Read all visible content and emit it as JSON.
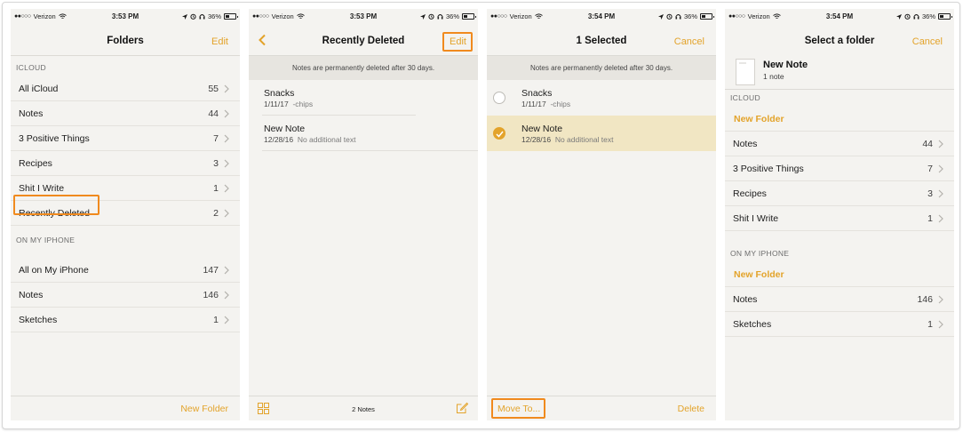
{
  "status": {
    "carrier": "Verizon",
    "battery": "36%",
    "time_a": "3:53 PM",
    "time_b": "3:54 PM"
  },
  "screen1": {
    "title": "Folders",
    "edit": "Edit",
    "section_icloud": "ICLOUD",
    "section_iphone": "ON MY IPHONE",
    "icloud_items": [
      {
        "label": "All iCloud",
        "count": "55"
      },
      {
        "label": "Notes",
        "count": "44"
      },
      {
        "label": "3 Positive Things",
        "count": "7"
      },
      {
        "label": "Recipes",
        "count": "3"
      },
      {
        "label": "Shit I Write",
        "count": "1"
      },
      {
        "label": "Recently Deleted",
        "count": "2"
      }
    ],
    "iphone_items": [
      {
        "label": "All on My iPhone",
        "count": "147"
      },
      {
        "label": "Notes",
        "count": "146"
      },
      {
        "label": "Sketches",
        "count": "1"
      }
    ],
    "new_folder": "New Folder"
  },
  "screen2": {
    "title": "Recently Deleted",
    "edit": "Edit",
    "banner": "Notes are permanently deleted after 30 days.",
    "notes": [
      {
        "title": "Snacks",
        "date": "1/11/17",
        "snippet": "-chips"
      },
      {
        "title": "New Note",
        "date": "12/28/16",
        "snippet": "No additional text"
      }
    ],
    "count": "2 Notes"
  },
  "screen3": {
    "title": "1 Selected",
    "cancel": "Cancel",
    "banner": "Notes are permanently deleted after 30 days.",
    "notes": [
      {
        "title": "Snacks",
        "date": "1/11/17",
        "snippet": "-chips"
      },
      {
        "title": "New Note",
        "date": "12/28/16",
        "snippet": "No additional text"
      }
    ],
    "move_to": "Move To...",
    "delete": "Delete"
  },
  "screen4": {
    "title": "Select a folder",
    "cancel": "Cancel",
    "note_title": "New Note",
    "note_count": "1 note",
    "section_icloud": "ICLOUD",
    "section_iphone": "ON MY IPHONE",
    "new_folder": "New Folder",
    "icloud_items": [
      {
        "label": "Notes",
        "count": "44"
      },
      {
        "label": "3 Positive Things",
        "count": "7"
      },
      {
        "label": "Recipes",
        "count": "3"
      },
      {
        "label": "Shit I Write",
        "count": "1"
      }
    ],
    "iphone_items": [
      {
        "label": "Notes",
        "count": "146"
      },
      {
        "label": "Sketches",
        "count": "1"
      }
    ]
  },
  "colors": {
    "accent": "#e3a32a",
    "highlight": "#f08a1e",
    "selected_row": "#f1e6c3"
  }
}
